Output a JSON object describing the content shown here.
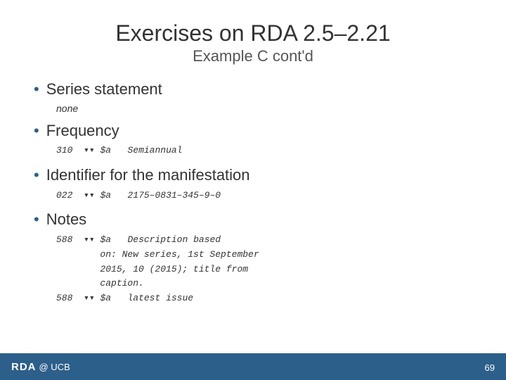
{
  "slide": {
    "main_title": "Exercises on RDA 2.5–2.21",
    "sub_title": "Example C cont'd",
    "bullets": [
      {
        "id": "series",
        "label": "Series statement",
        "content_type": "plain",
        "content": "none"
      },
      {
        "id": "frequency",
        "label": "Frequency",
        "content_type": "marc",
        "content": "310  $a  $ad Semiannual"
      },
      {
        "id": "identifier",
        "label": "Identifier for the manifestation",
        "content_type": "marc",
        "content": "022  $a  $ad 2175‑0831‑345‑9‑0"
      },
      {
        "id": "notes",
        "label": "Notes",
        "content_type": "marc_multiline",
        "lines": [
          "588  $a  $ad Description based",
          "on: New series, 1st September",
          "2015, 10 (2015); title from",
          "caption.",
          "588  $a  $ad latest issue"
        ]
      }
    ],
    "footer": {
      "logo": "RDA",
      "text": "@ UCB",
      "page": "69"
    }
  }
}
